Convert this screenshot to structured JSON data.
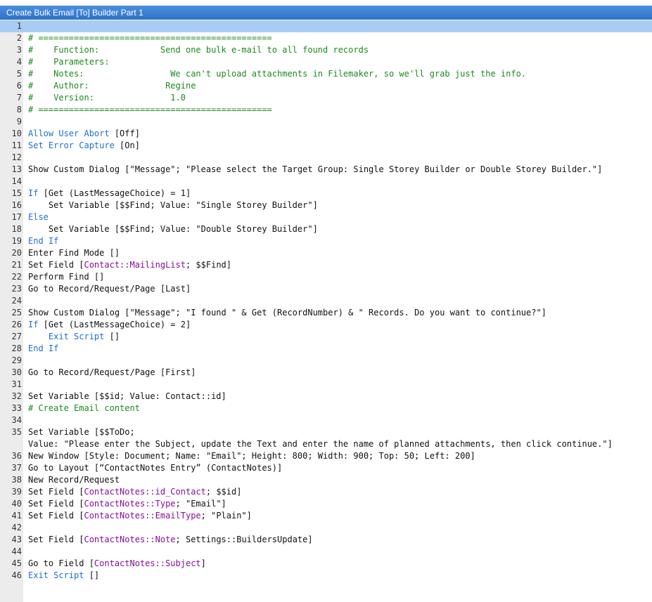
{
  "window": {
    "title": "Create Bulk Email [To] Builder Part 1"
  },
  "colors": {
    "keyword": "#1f6fd1",
    "comment": "#1e8a1e",
    "field": "#8a0aa0",
    "titlebar": "#3a7bd5"
  },
  "lines": [
    {
      "n": "1",
      "parts": []
    },
    {
      "n": "2",
      "parts": [
        {
          "t": "# ==============================================",
          "c": "cm"
        }
      ]
    },
    {
      "n": "3",
      "parts": [
        {
          "t": "#    Function:            Send one bulk e-mail to all found records",
          "c": "cm"
        }
      ]
    },
    {
      "n": "4",
      "parts": [
        {
          "t": "#    Parameters:",
          "c": "cm"
        }
      ]
    },
    {
      "n": "5",
      "parts": [
        {
          "t": "#    Notes:                 We can't upload attachments in Filemaker, so we'll grab just the info.",
          "c": "cm"
        }
      ]
    },
    {
      "n": "6",
      "parts": [
        {
          "t": "#    Author:               Regine",
          "c": "cm"
        }
      ]
    },
    {
      "n": "7",
      "parts": [
        {
          "t": "#    Version:               1.0",
          "c": "cm"
        }
      ]
    },
    {
      "n": "8",
      "parts": [
        {
          "t": "# ==============================================",
          "c": "cm"
        }
      ]
    },
    {
      "n": "9",
      "parts": []
    },
    {
      "n": "10",
      "parts": [
        {
          "t": "Allow User Abort",
          "c": "kw"
        },
        {
          "t": " [Off]",
          "c": ""
        }
      ]
    },
    {
      "n": "11",
      "parts": [
        {
          "t": "Set Error Capture",
          "c": "kw"
        },
        {
          "t": " [On]",
          "c": ""
        }
      ]
    },
    {
      "n": "12",
      "parts": []
    },
    {
      "n": "13",
      "parts": [
        {
          "t": "Show Custom Dialog [\"Message\"; \"Please select the Target Group: Single Storey Builder or Double Storey Builder.\"]",
          "c": ""
        }
      ]
    },
    {
      "n": "14",
      "parts": []
    },
    {
      "n": "15",
      "parts": [
        {
          "t": "If",
          "c": "kw"
        },
        {
          "t": " [Get (LastMessageChoice) = 1]",
          "c": ""
        }
      ]
    },
    {
      "n": "16",
      "parts": [
        {
          "t": "    Set Variable [$$Find; Value: \"Single Storey Builder\"]",
          "c": ""
        }
      ]
    },
    {
      "n": "17",
      "parts": [
        {
          "t": "Else",
          "c": "kw"
        }
      ]
    },
    {
      "n": "18",
      "parts": [
        {
          "t": "    Set Variable [$$Find; Value: \"Double Storey Builder\"]",
          "c": ""
        }
      ]
    },
    {
      "n": "19",
      "parts": [
        {
          "t": "End If",
          "c": "kw"
        }
      ]
    },
    {
      "n": "20",
      "parts": [
        {
          "t": "Enter Find Mode []",
          "c": ""
        }
      ]
    },
    {
      "n": "21",
      "parts": [
        {
          "t": "Set Field [",
          "c": ""
        },
        {
          "t": "Contact::MailingList",
          "c": "fd"
        },
        {
          "t": "; $$Find]",
          "c": ""
        }
      ]
    },
    {
      "n": "22",
      "parts": [
        {
          "t": "Perform Find []",
          "c": ""
        }
      ]
    },
    {
      "n": "23",
      "parts": [
        {
          "t": "Go to Record/Request/Page [Last]",
          "c": ""
        }
      ]
    },
    {
      "n": "24",
      "parts": []
    },
    {
      "n": "25",
      "parts": [
        {
          "t": "Show Custom Dialog [\"Message\"; \"I found \" & Get (RecordNumber) & \" Records. Do you want to continue?\"]",
          "c": ""
        }
      ]
    },
    {
      "n": "26",
      "parts": [
        {
          "t": "If",
          "c": "kw"
        },
        {
          "t": " [Get (LastMessageChoice) = 2]",
          "c": ""
        }
      ]
    },
    {
      "n": "27",
      "parts": [
        {
          "t": "    ",
          "c": ""
        },
        {
          "t": "Exit Script",
          "c": "kw"
        },
        {
          "t": " []",
          "c": ""
        }
      ]
    },
    {
      "n": "28",
      "parts": [
        {
          "t": "End If",
          "c": "kw"
        }
      ]
    },
    {
      "n": "29",
      "parts": []
    },
    {
      "n": "30",
      "parts": [
        {
          "t": "Go to Record/Request/Page [First]",
          "c": ""
        }
      ]
    },
    {
      "n": "31",
      "parts": []
    },
    {
      "n": "32",
      "parts": [
        {
          "t": "Set Variable [$$id; Value: Contact::id]",
          "c": ""
        }
      ]
    },
    {
      "n": "33",
      "parts": [
        {
          "t": "# Create Email content",
          "c": "cm"
        }
      ]
    },
    {
      "n": "34",
      "parts": []
    },
    {
      "n": "35",
      "parts": [
        {
          "t": "Set Variable [$$ToDo;",
          "c": ""
        }
      ]
    },
    {
      "n": "",
      "parts": [
        {
          "t": "Value: \"Please enter the Subject, update the Text and enter the name of planned attachments, then click continue.\"]",
          "c": ""
        }
      ]
    },
    {
      "n": "36",
      "parts": [
        {
          "t": "New Window [Style: Document; Name: \"Email\"; Height: 800; Width: 900; Top: 50; Left: 200]",
          "c": ""
        }
      ]
    },
    {
      "n": "37",
      "parts": [
        {
          "t": "Go to Layout [“ContactNotes Entry” (ContactNotes)]",
          "c": ""
        }
      ]
    },
    {
      "n": "38",
      "parts": [
        {
          "t": "New Record/Request",
          "c": ""
        }
      ]
    },
    {
      "n": "39",
      "parts": [
        {
          "t": "Set Field [",
          "c": ""
        },
        {
          "t": "ContactNotes::id_Contact",
          "c": "fd"
        },
        {
          "t": "; $$id]",
          "c": ""
        }
      ]
    },
    {
      "n": "40",
      "parts": [
        {
          "t": "Set Field [",
          "c": ""
        },
        {
          "t": "ContactNotes::Type",
          "c": "fd"
        },
        {
          "t": "; \"Email\"]",
          "c": ""
        }
      ]
    },
    {
      "n": "41",
      "parts": [
        {
          "t": "Set Field [",
          "c": ""
        },
        {
          "t": "ContactNotes::EmailType",
          "c": "fd"
        },
        {
          "t": "; \"Plain\"]",
          "c": ""
        }
      ]
    },
    {
      "n": "42",
      "parts": []
    },
    {
      "n": "43",
      "parts": [
        {
          "t": "Set Field [",
          "c": ""
        },
        {
          "t": "ContactNotes::Note",
          "c": "fd"
        },
        {
          "t": "; Settings::BuildersUpdate]",
          "c": ""
        }
      ]
    },
    {
      "n": "44",
      "parts": []
    },
    {
      "n": "45",
      "parts": [
        {
          "t": "Go to Field [",
          "c": ""
        },
        {
          "t": "ContactNotes::Subject",
          "c": "fd"
        },
        {
          "t": "]",
          "c": ""
        }
      ]
    },
    {
      "n": "46",
      "parts": [
        {
          "t": "Exit Script",
          "c": "kw"
        },
        {
          "t": " []",
          "c": ""
        }
      ]
    }
  ]
}
